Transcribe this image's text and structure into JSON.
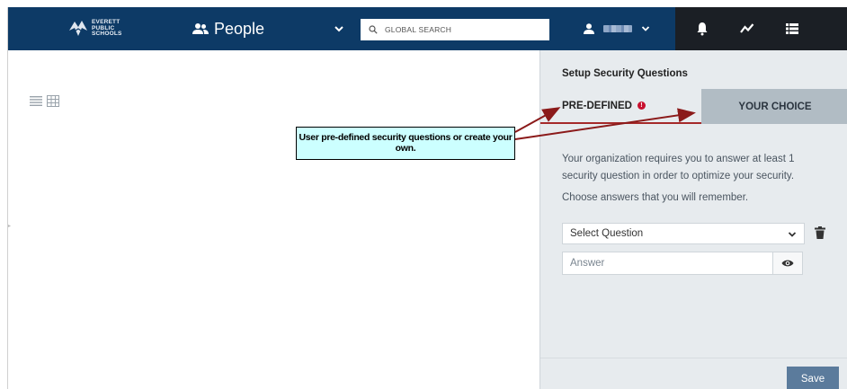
{
  "header": {
    "logo_text": [
      "Everett",
      "Public",
      "Schools"
    ],
    "app_name": "People",
    "search": {
      "placeholder": "GLOBAL SEARCH",
      "value": ""
    }
  },
  "panel": {
    "title": "Setup Security Questions",
    "tabs": [
      {
        "label": "PRE-DEFINED",
        "active": true,
        "alert_badge": "!"
      },
      {
        "label": "YOUR CHOICE",
        "active": false
      }
    ],
    "info": "Your organization requires you to answer at least 1 security question in order to optimize your security.",
    "hint": "Choose answers that you will remember.",
    "question_select": {
      "selected": "Select Question"
    },
    "answer_field": {
      "placeholder": "Answer",
      "value": ""
    },
    "save_label": "Save"
  },
  "callout": {
    "text": "User pre-defined security questions or create your own."
  },
  "colors": {
    "header_bg": "#0d3a66",
    "header_dark": "#1b1f25",
    "panel_bg": "#e7ebee",
    "tab_inactive_bg": "#b1bcc4",
    "save_bg": "#5b7b9c",
    "callout_bg": "#ccffff",
    "arrow": "#8b1a1a",
    "alert": "#c8102e"
  },
  "icons": [
    "logo-mark",
    "people-icon",
    "chevron-down-icon",
    "search-icon",
    "user-icon",
    "bell-icon",
    "activity-icon",
    "list-icon",
    "list-view-icon",
    "grid-view-icon",
    "trash-icon",
    "eye-icon"
  ]
}
